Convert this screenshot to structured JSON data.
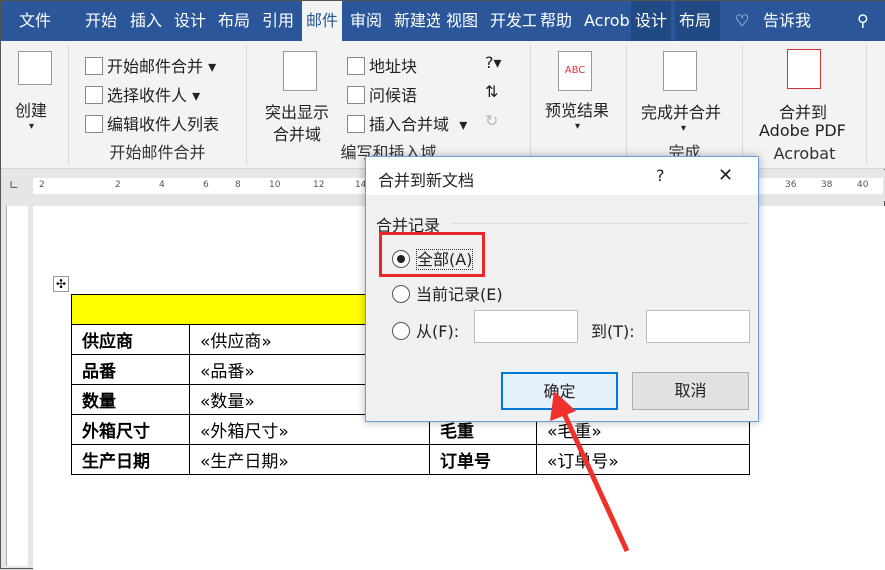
{
  "tabs": [
    "文件",
    "开始",
    "插入",
    "设计",
    "布局",
    "引用",
    "邮件",
    "审阅",
    "新建选",
    "视图",
    "开发工",
    "帮助",
    "Acrobat",
    "设计",
    "布局",
    "告诉我"
  ],
  "ribbon": {
    "create": "创建",
    "start_group": {
      "items": [
        "开始邮件合并",
        "选择收件人",
        "编辑收件人列表"
      ],
      "label": "开始邮件合并"
    },
    "write_group": {
      "highlight": "突出显示",
      "highlight2": "合并域",
      "items": [
        "地址块",
        "问候语",
        "插入合并域"
      ],
      "label": "编写和插入域"
    },
    "preview": "预览结果",
    "finish": {
      "button": "完成并合并",
      "label": "完成"
    },
    "acrobat": {
      "line1": "合并到",
      "line2": "Adobe PDF",
      "label": "Acrobat"
    }
  },
  "ruler": [
    "2",
    "2",
    "4",
    "6",
    "8",
    "10",
    "12",
    "14",
    "36",
    "38",
    "40"
  ],
  "table": {
    "rows": [
      [
        "供应商",
        "«供应商»",
        "",
        ""
      ],
      [
        "品番",
        "«品番»",
        "",
        ""
      ],
      [
        "数量",
        "«数量»",
        "",
        ""
      ],
      [
        "外箱尺寸",
        "«外箱尺寸»",
        "毛重",
        "«毛重»"
      ],
      [
        "生产日期",
        "«生产日期»",
        "订单号",
        "«订单号»"
      ]
    ]
  },
  "dialog": {
    "title": "合并到新文档",
    "help": "?",
    "close": "✕",
    "section": "合并记录",
    "all": "全部(A)",
    "current": "当前记录(E)",
    "from": "从(F):",
    "to": "到(T):",
    "ok": "确定",
    "cancel": "取消"
  },
  "colors": {
    "accent": "#2b579a",
    "highlight": "#ff0000",
    "header_row": "#ffff00"
  }
}
